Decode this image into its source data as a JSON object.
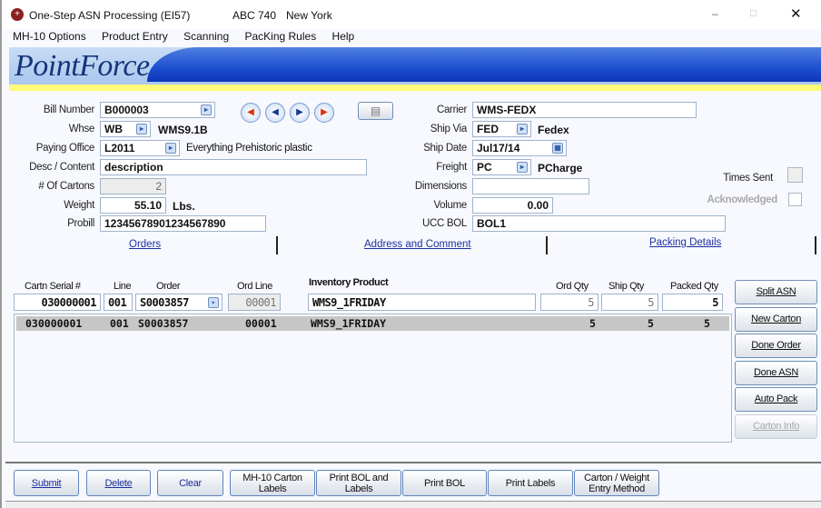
{
  "window": {
    "title": "One-Step ASN Processing (EI57)",
    "company": "ABC 740",
    "location": "New York",
    "controls": {
      "minimize": "–",
      "maximize": "□",
      "close": "✕"
    }
  },
  "menu": [
    "MH-10 Options",
    "Product Entry",
    "Scanning",
    "PacKing Rules",
    "Help"
  ],
  "brand": {
    "logo": "PointForce"
  },
  "header": {
    "bill_number": {
      "label": "Bill Number",
      "value": "B000003"
    },
    "whse": {
      "label": "Whse",
      "value": "WB",
      "desc": "WMS9.1B"
    },
    "paying_office": {
      "label": "Paying Office",
      "value": "L2011",
      "desc": "Everything Prehistoric plastic"
    },
    "desc_content": {
      "label": "Desc / Content",
      "value": "description"
    },
    "cartons": {
      "label": "# Of Cartons",
      "value": "2"
    },
    "weight": {
      "label": "Weight",
      "value": "55.10",
      "unit": "Lbs."
    },
    "probill": {
      "label": "Probill",
      "value": "12345678901234567890"
    },
    "carrier": {
      "label": "Carrier",
      "value": "WMS-FEDX"
    },
    "ship_via": {
      "label": "Ship Via",
      "value": "FED",
      "desc": "Fedex"
    },
    "ship_date": {
      "label": "Ship Date",
      "value": "Jul17/14"
    },
    "freight": {
      "label": "Freight",
      "value": "PC",
      "desc": "PCharge"
    },
    "dimensions": {
      "label": "Dimensions",
      "value": ""
    },
    "volume": {
      "label": "Volume",
      "value": "0.00"
    },
    "ucc_bol": {
      "label": "UCC BOL",
      "value": "BOL1"
    },
    "times_sent": {
      "label": "Times Sent"
    },
    "acknowledged": {
      "label": "Acknowledged"
    }
  },
  "tabs": [
    "Orders",
    "Address and Comment",
    "Packing Details"
  ],
  "lines": {
    "headers": [
      "Cartn Serial #",
      "Line",
      "Order",
      "Ord Line",
      "Inventory Product",
      "Ord Qty",
      "Ship Qty",
      "Packed Qty"
    ],
    "entry": {
      "serial": "030000001",
      "line": "001",
      "order": "S0003857",
      "ord_line": "00001",
      "product": "WMS9_1FRIDAY",
      "ord_qty": "5",
      "ship_qty": "5",
      "packed_qty": "5"
    },
    "rows": [
      {
        "serial": "030000001",
        "line": "001",
        "order": "S0003857",
        "ord_line": "00001",
        "product": "WMS9_1FRIDAY",
        "ord_qty": "5",
        "ship_qty": "5",
        "packed_qty": "5"
      }
    ]
  },
  "side_buttons": [
    "Split ASN",
    "New Carton",
    "Done Order",
    "Done ASN",
    "Auto Pack",
    "Carton Info"
  ],
  "bottom_buttons": [
    "Submit",
    "Delete",
    "Clear",
    "MH-10 Carton Labels",
    "Print BOL and Labels",
    "Print BOL",
    "Print Labels",
    "Carton / Weight Entry Method"
  ]
}
